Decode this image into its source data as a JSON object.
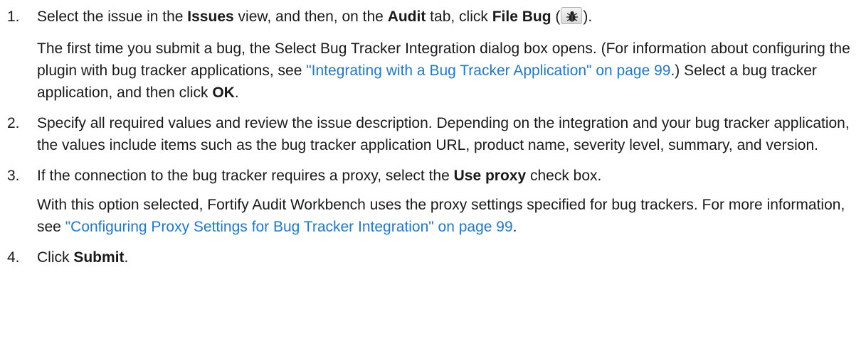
{
  "steps": [
    {
      "number": "1.",
      "line1": {
        "t1": "Select the issue in the ",
        "b1": "Issues",
        "t2": " view, and then, on the ",
        "b2": "Audit",
        "t3": " tab, click ",
        "b3": "File Bug",
        "t4": " (",
        "icon": "bug-icon",
        "t5": ")."
      },
      "line2": {
        "t1": "The first time you submit a bug, the Select Bug Tracker Integration dialog box opens. (For information about configuring the plugin with bug tracker applications, see ",
        "link": "\"Integrating with a Bug Tracker Application\" on page 99",
        "t2": ".) Select a bug tracker application, and then click ",
        "b1": "OK",
        "t3": "."
      }
    },
    {
      "number": "2.",
      "text": "Specify all required values and review the issue description. Depending on the integration and your bug tracker application, the values include items such as the bug tracker application URL, product name, severity level, summary, and version."
    },
    {
      "number": "3.",
      "line1": {
        "t1": "If the connection to the bug tracker requires a proxy, select the ",
        "b1": "Use proxy",
        "t2": " check box."
      },
      "line2": {
        "t1": "With this option selected, Fortify Audit Workbench uses the proxy settings specified for bug trackers. For more information, see ",
        "link": "\"Configuring Proxy Settings for Bug Tracker Integration\" on page 99",
        "t2": "."
      }
    },
    {
      "number": "4.",
      "t1": "Click ",
      "b1": "Submit",
      "t2": "."
    }
  ],
  "colors": {
    "text": "#1a1a1a",
    "link": "#1b7ad3"
  }
}
